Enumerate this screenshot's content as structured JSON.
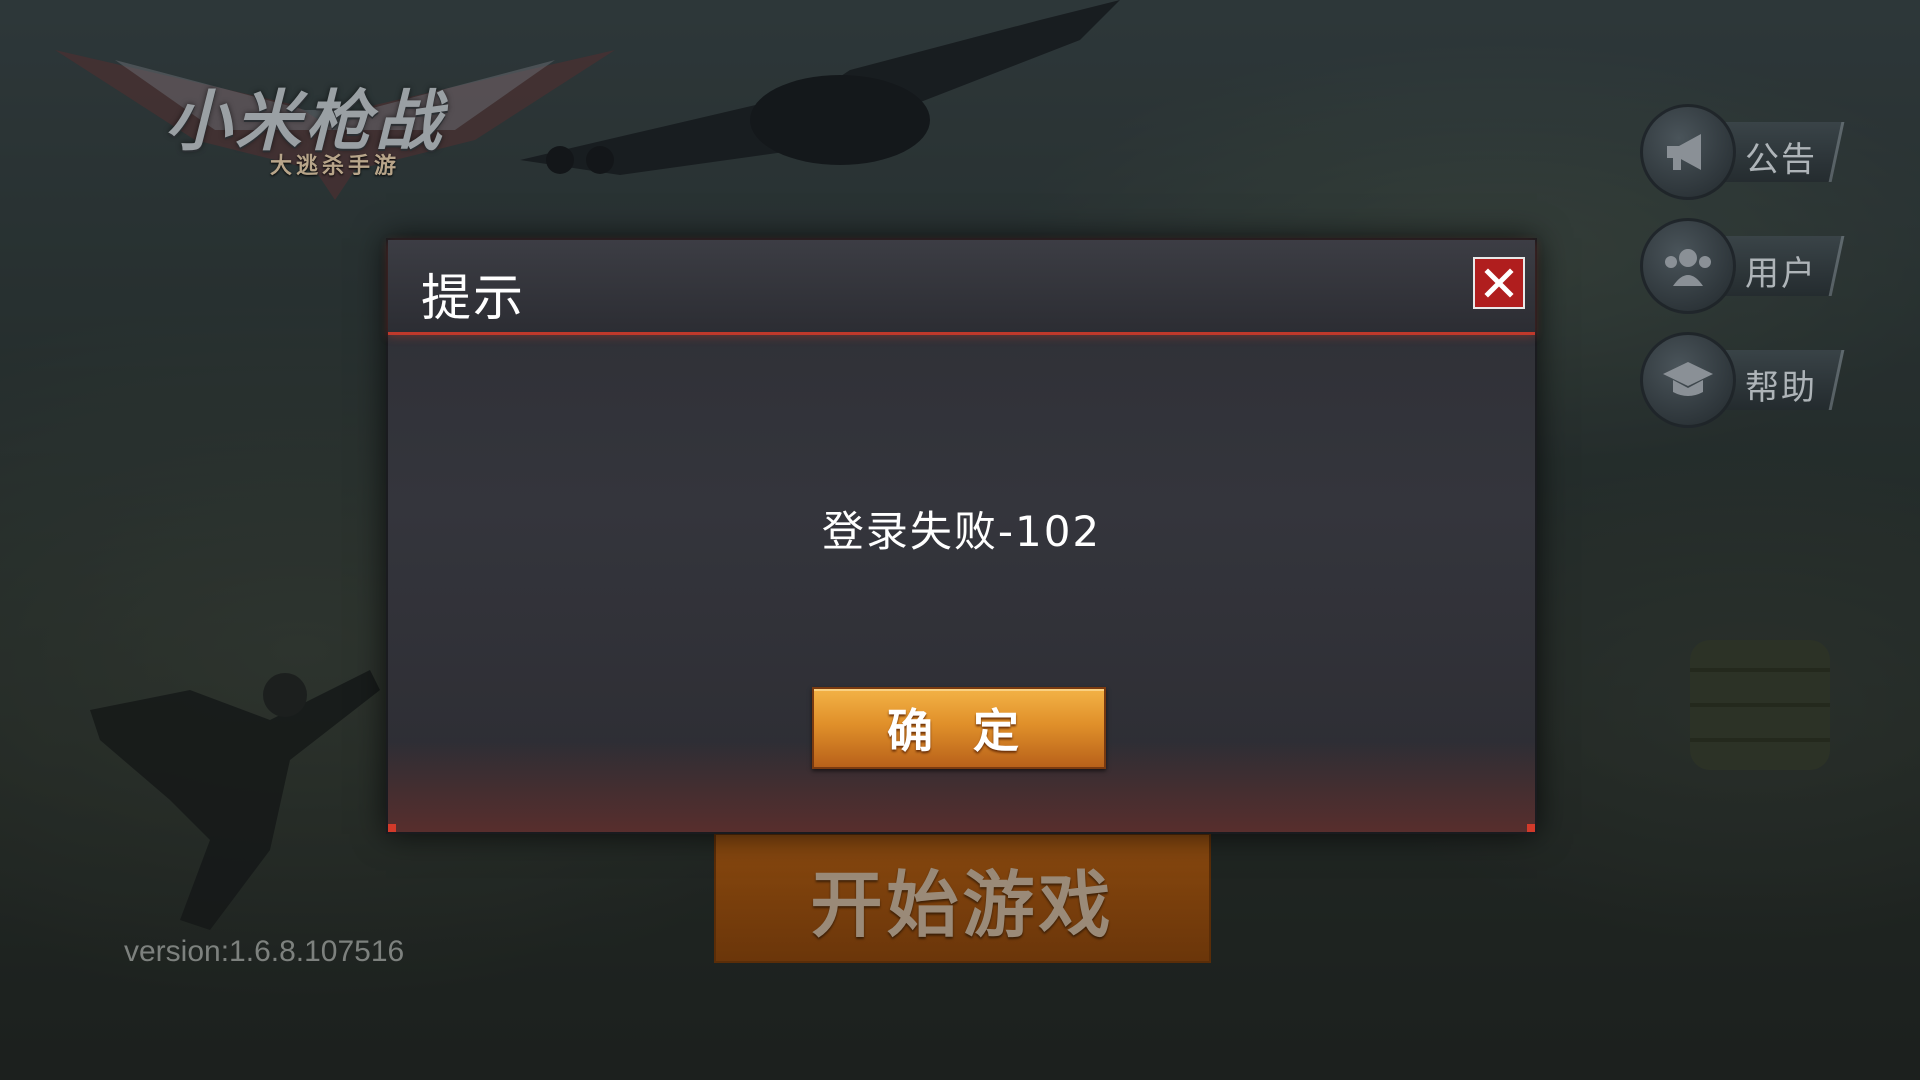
{
  "logo": {
    "title": "小米枪战",
    "subtitle": "大逃杀手游"
  },
  "side_menu": [
    {
      "label": "公告",
      "icon": "megaphone-icon"
    },
    {
      "label": "用户",
      "icon": "users-icon"
    },
    {
      "label": "帮助",
      "icon": "graduation-cap-icon"
    }
  ],
  "start_button": {
    "label": "开始游戏"
  },
  "version": "version:1.6.8.107516",
  "dialog": {
    "title": "提示",
    "message": "登录失败-102",
    "confirm_label": "确 定",
    "close_icon": "close-icon"
  },
  "colors": {
    "accent_red": "#c0392b",
    "button_orange": "#e0902a",
    "close_red": "#b01e1e"
  }
}
